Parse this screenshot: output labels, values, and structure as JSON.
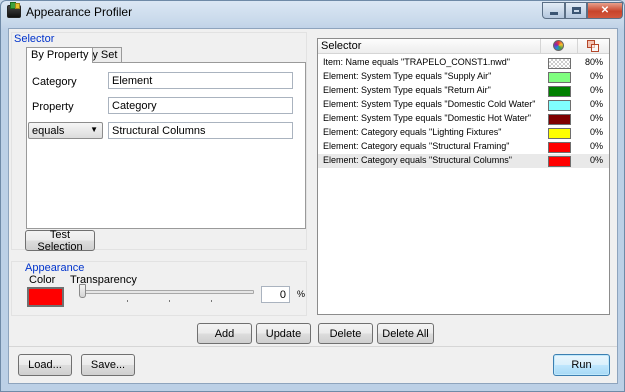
{
  "window": {
    "title": "Appearance Profiler"
  },
  "selector_group": {
    "label": "Selector",
    "tabs": [
      "By Property",
      "By Set"
    ],
    "category_label": "Category",
    "category_value": "Element",
    "property_label": "Property",
    "property_value": "Category",
    "operator_value": "equals",
    "value_value": "Structural Columns",
    "test_button": "Test Selection"
  },
  "appearance_group": {
    "label": "Appearance",
    "color_label": "Color",
    "color_value": "#ff0000",
    "transparency_label": "Transparency",
    "transparency_value": "0",
    "transparency_unit": "%"
  },
  "selector_list": {
    "header": "Selector",
    "color_icon": "color-wheel-icon",
    "transparency_icon": "transparency-icon",
    "rows": [
      {
        "text": "Item: Name equals \"TRAPELO_CONST1.nwd\"",
        "color": "checker",
        "pct": "80%"
      },
      {
        "text": "Element: System Type equals \"Supply Air\"",
        "color": "#80ff80",
        "pct": "0%"
      },
      {
        "text": "Element: System Type equals \"Return Air\"",
        "color": "#008000",
        "pct": "0%"
      },
      {
        "text": "Element: System Type equals \"Domestic Cold Water\"",
        "color": "#80ffff",
        "pct": "0%"
      },
      {
        "text": "Element: System Type equals \"Domestic Hot Water\"",
        "color": "#800000",
        "pct": "0%"
      },
      {
        "text": "Element: Category equals \"Lighting Fixtures\"",
        "color": "#ffff00",
        "pct": "0%"
      },
      {
        "text": "Element: Category equals \"Structural Framing\"",
        "color": "#ff0000",
        "pct": "0%"
      },
      {
        "text": "Element: Category equals \"Structural Columns\"",
        "color": "#ff0000",
        "pct": "0%",
        "selected": true
      }
    ]
  },
  "actions": {
    "add": "Add",
    "update": "Update",
    "delete": "Delete",
    "delete_all": "Delete All"
  },
  "footer": {
    "load": "Load...",
    "save": "Save...",
    "run": "Run"
  }
}
